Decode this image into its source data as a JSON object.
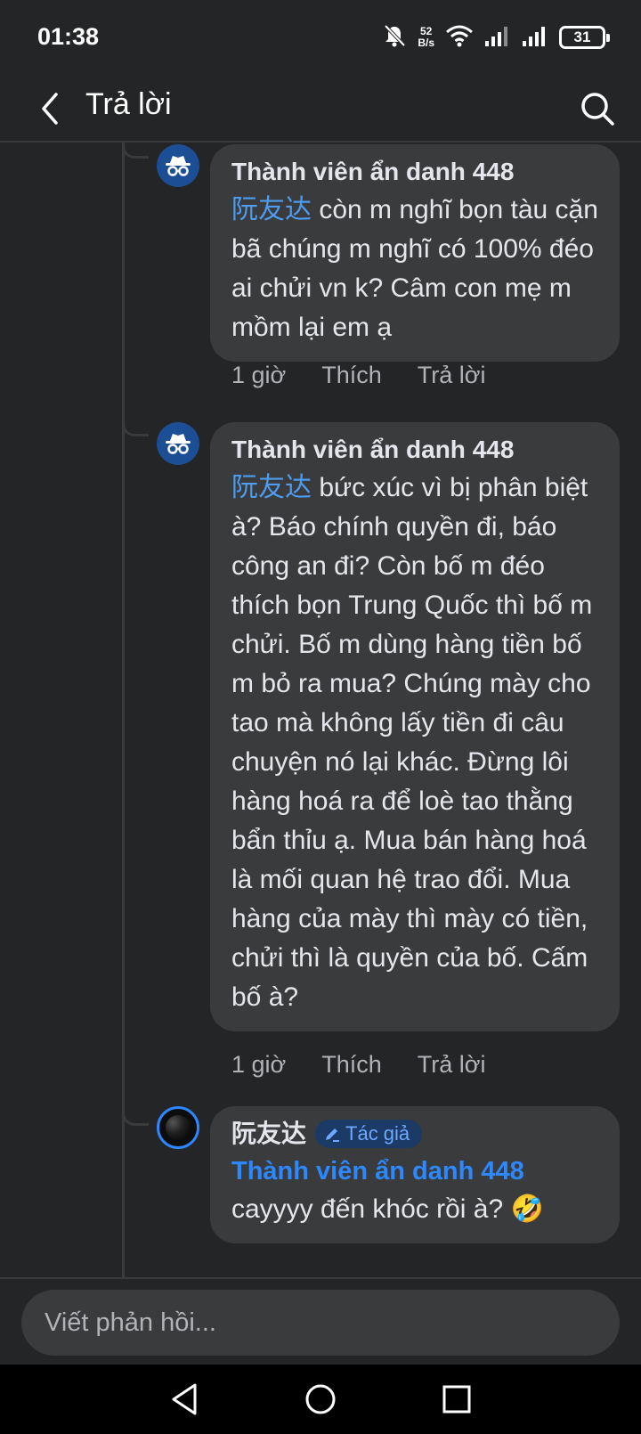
{
  "status_bar": {
    "time": "01:38",
    "net_speed_value": "52",
    "net_speed_unit": "B/s",
    "battery": "31",
    "icons": [
      "mute-bell-icon",
      "wifi-icon",
      "signal-icon",
      "signal-icon",
      "battery-icon"
    ]
  },
  "header": {
    "title": "Trả lời",
    "back_icon": "chevron-left-icon",
    "search_icon": "search-icon"
  },
  "comments": [
    {
      "author": "Thành viên ẩn danh 448",
      "mention": "阮友达",
      "text": "còn m nghĩ bọn tàu cặn bã chúng m nghĩ có 100% đéo ai chửi vn k? Câm con mẹ m mồm lại em ạ",
      "time": "1 giờ",
      "like": "Thích",
      "reply": "Trả lời"
    },
    {
      "author": "Thành viên ẩn danh 448",
      "mention": "阮友达",
      "text": "bức xúc vì bị phân biệt à? Báo chính quyền đi, báo công an đi? Còn bố m đéo thích bọn Trung Quốc thì bố m chửi. Bố m dùng hàng tiền bố m bỏ ra mua? Chúng mày cho tao mà không lấy tiền đi câu chuyện nó lại khác. Đừng lôi hàng hoá ra để loè tao thằng bẩn thỉu ạ. Mua bán hàng hoá là mối quan hệ trao đổi. Mua hàng của mày thì mày có tiền, chửi thì là quyền của bố. Cấm bố à?",
      "time": "1 giờ",
      "like": "Thích",
      "reply": "Trả lời"
    },
    {
      "author": "阮友达",
      "badge": "Tác giả",
      "mention": "Thành viên ẩn danh 448",
      "text": "cayyyy đến khóc rồi à? 🤣"
    }
  ],
  "reply_box": {
    "placeholder": "Viết phản hồi..."
  },
  "nav": {
    "back": "nav-back-icon",
    "home": "nav-home-icon",
    "recents": "nav-recents-icon"
  },
  "colors": {
    "background": "#242526",
    "bubble": "#3a3b3c",
    "accent": "#2d88ff",
    "mention": "#4d9cf0",
    "secondary_text": "#b0b3b8"
  }
}
